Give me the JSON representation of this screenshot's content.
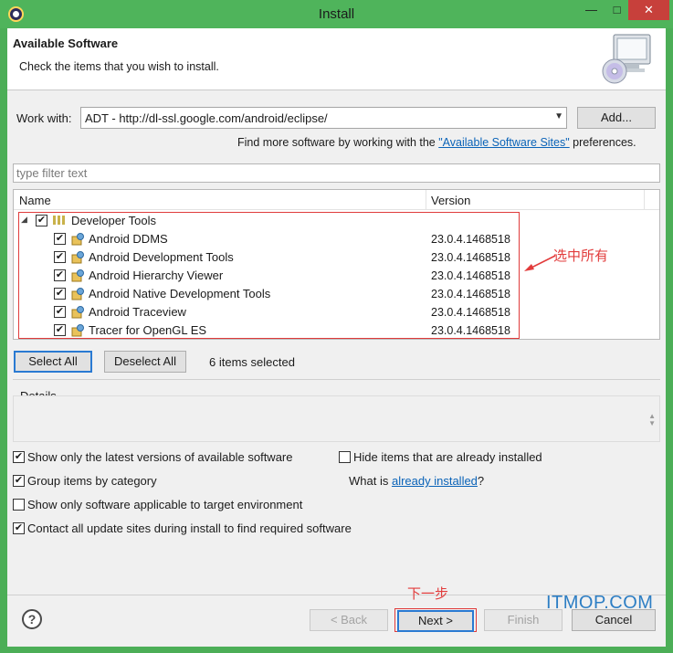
{
  "window": {
    "title": "Install"
  },
  "banner": {
    "title": "Available Software",
    "subtitle": "Check the items that you wish to install."
  },
  "work_with": {
    "label": "Work with:",
    "value": "ADT - http://dl-ssl.google.com/android/eclipse/",
    "add_button": "Add..."
  },
  "more_software": {
    "prefix": "Find more software by working with the ",
    "link": "\"Available Software Sites\"",
    "suffix": " preferences."
  },
  "filter": {
    "placeholder": "type filter text"
  },
  "tree": {
    "columns": {
      "name": "Name",
      "version": "Version"
    },
    "category": {
      "name": "Developer Tools",
      "checked": true,
      "expanded": true
    },
    "items": [
      {
        "name": "Android DDMS",
        "version": "23.0.4.1468518",
        "checked": true
      },
      {
        "name": "Android Development Tools",
        "version": "23.0.4.1468518",
        "checked": true
      },
      {
        "name": "Android Hierarchy Viewer",
        "version": "23.0.4.1468518",
        "checked": true
      },
      {
        "name": "Android Native Development Tools",
        "version": "23.0.4.1468518",
        "checked": true
      },
      {
        "name": "Android Traceview",
        "version": "23.0.4.1468518",
        "checked": true
      },
      {
        "name": "Tracer for OpenGL ES",
        "version": "23.0.4.1468518",
        "checked": true
      }
    ]
  },
  "selection": {
    "select_all": "Select All",
    "deselect_all": "Deselect All",
    "status": "6 items selected"
  },
  "details": {
    "label": "Details"
  },
  "options": {
    "latest_versions": {
      "label": "Show only the latest versions of available software",
      "checked": true
    },
    "hide_installed": {
      "label": "Hide items that are already installed",
      "checked": false
    },
    "group_category": {
      "label": "Group items by category",
      "checked": true
    },
    "what_is_prefix": "What is ",
    "already_installed_link": "already installed",
    "what_is_suffix": "?",
    "target_env": {
      "label": "Show only software applicable to target environment",
      "checked": false
    },
    "contact_sites": {
      "label": "Contact all update sites during install to find required software",
      "checked": true
    }
  },
  "footer": {
    "back": "< Back",
    "next": "Next >",
    "finish": "Finish",
    "cancel": "Cancel"
  },
  "annotations": {
    "select_all_note": "选中所有",
    "next_step_note": "下一步",
    "color": "#e23c3c"
  },
  "watermark": "ITMOP.COM"
}
